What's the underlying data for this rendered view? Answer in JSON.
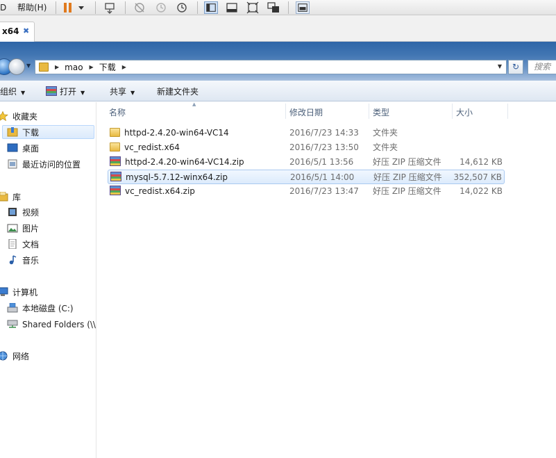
{
  "vm_toolbar": {
    "menu_partial": "D",
    "help_menu": "帮助(H)",
    "icons": [
      "pause-icon",
      "dropdown-arrow-icon",
      "send-keys-icon",
      "snapshot-disabled-icon",
      "snapshot-restore-icon",
      "snapshot-manager-icon",
      "sidebar-view-icon",
      "console-view-icon",
      "fullscreen-icon",
      "unity-icon",
      "thumbnail-icon"
    ]
  },
  "tab": {
    "label": "x64",
    "close_glyph": "✖"
  },
  "address": {
    "crumbs": [
      "mao",
      "下载"
    ],
    "search_placeholder": "搜索"
  },
  "command_bar": {
    "organize": "组织",
    "open": "打开",
    "share": "共享",
    "new_folder": "新建文件夹"
  },
  "nav_pane": {
    "favorites": "收藏夹",
    "downloads": "下载",
    "desktop": "桌面",
    "recent": "最近访问的位置",
    "libraries": "库",
    "videos": "视频",
    "pictures": "图片",
    "documents": "文档",
    "music": "音乐",
    "computer": "计算机",
    "local_disk": "本地磁盘 (C:)",
    "shared_folders": "Shared Folders (\\\\",
    "network": "网络"
  },
  "columns": {
    "name": "名称",
    "date": "修改日期",
    "type": "类型",
    "size": "大小"
  },
  "files": [
    {
      "name": "httpd-2.4.20-win64-VC14",
      "date": "2016/7/23 14:33",
      "type": "文件夹",
      "size": "",
      "kind": "folder"
    },
    {
      "name": "vc_redist.x64",
      "date": "2016/7/23 13:50",
      "type": "文件夹",
      "size": "",
      "kind": "folder"
    },
    {
      "name": "httpd-2.4.20-win64-VC14.zip",
      "date": "2016/5/1 13:56",
      "type": "好压 ZIP 压缩文件",
      "size": "14,612 KB",
      "kind": "zip"
    },
    {
      "name": "mysql-5.7.12-winx64.zip",
      "date": "2016/5/1 14:00",
      "type": "好压 ZIP 压缩文件",
      "size": "352,507 KB",
      "kind": "zip"
    },
    {
      "name": "vc_redist.x64.zip",
      "date": "2016/7/23 13:47",
      "type": "好压 ZIP 压缩文件",
      "size": "14,022 KB",
      "kind": "zip"
    }
  ]
}
